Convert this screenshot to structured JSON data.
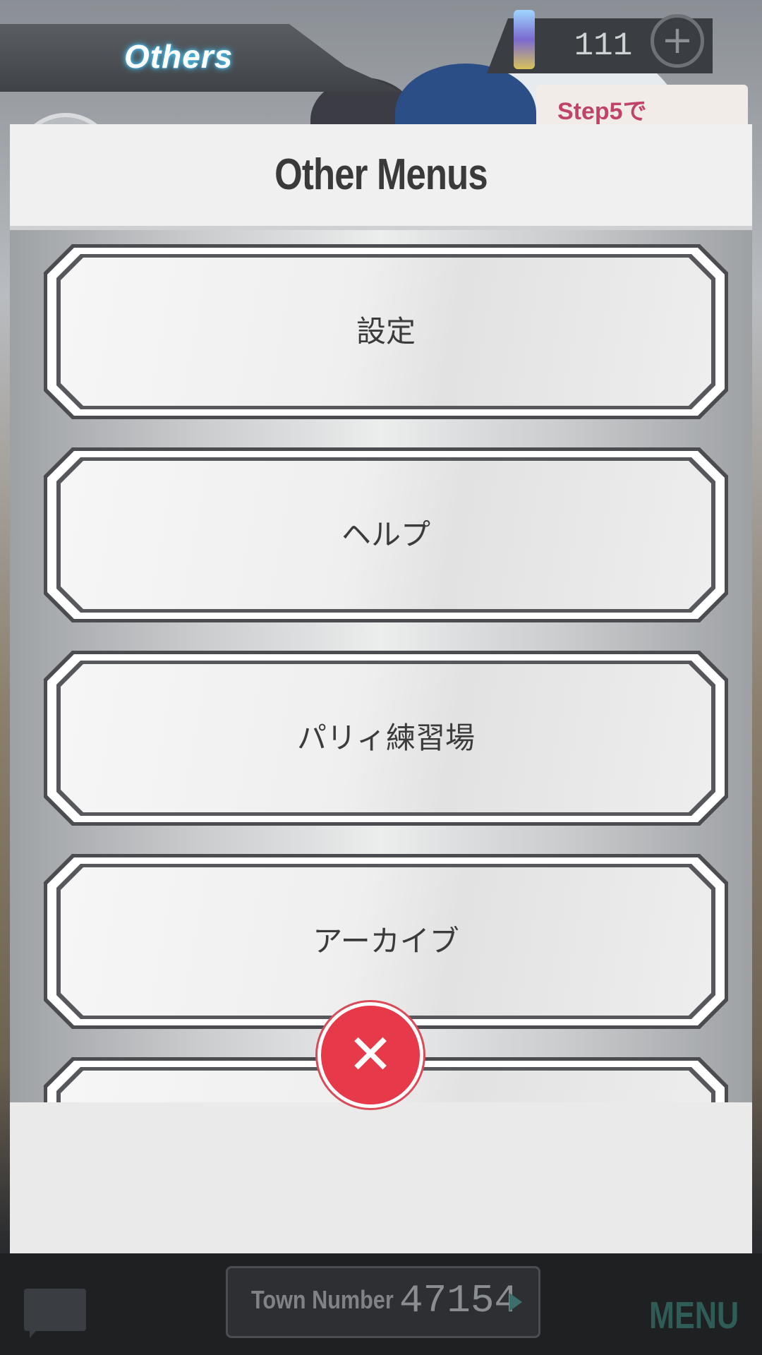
{
  "header": {
    "tab_title": "Others",
    "currency_value": "111",
    "add_currency_icon": "plus-icon",
    "promo_text": "Step5で"
  },
  "modal": {
    "title": "Other Menus",
    "items": [
      {
        "label": "設定"
      },
      {
        "label": "ヘルプ"
      },
      {
        "label": "パリィ練習場"
      },
      {
        "label": "アーカイブ"
      },
      {
        "label": ""
      }
    ],
    "close_icon": "close-icon",
    "close_glyph": "✕",
    "accent_color": "#e63a4b"
  },
  "footer": {
    "town_label": "Town Number",
    "town_number": "47154",
    "menu_label": "MENU",
    "chat_icon": "chat-icon"
  }
}
